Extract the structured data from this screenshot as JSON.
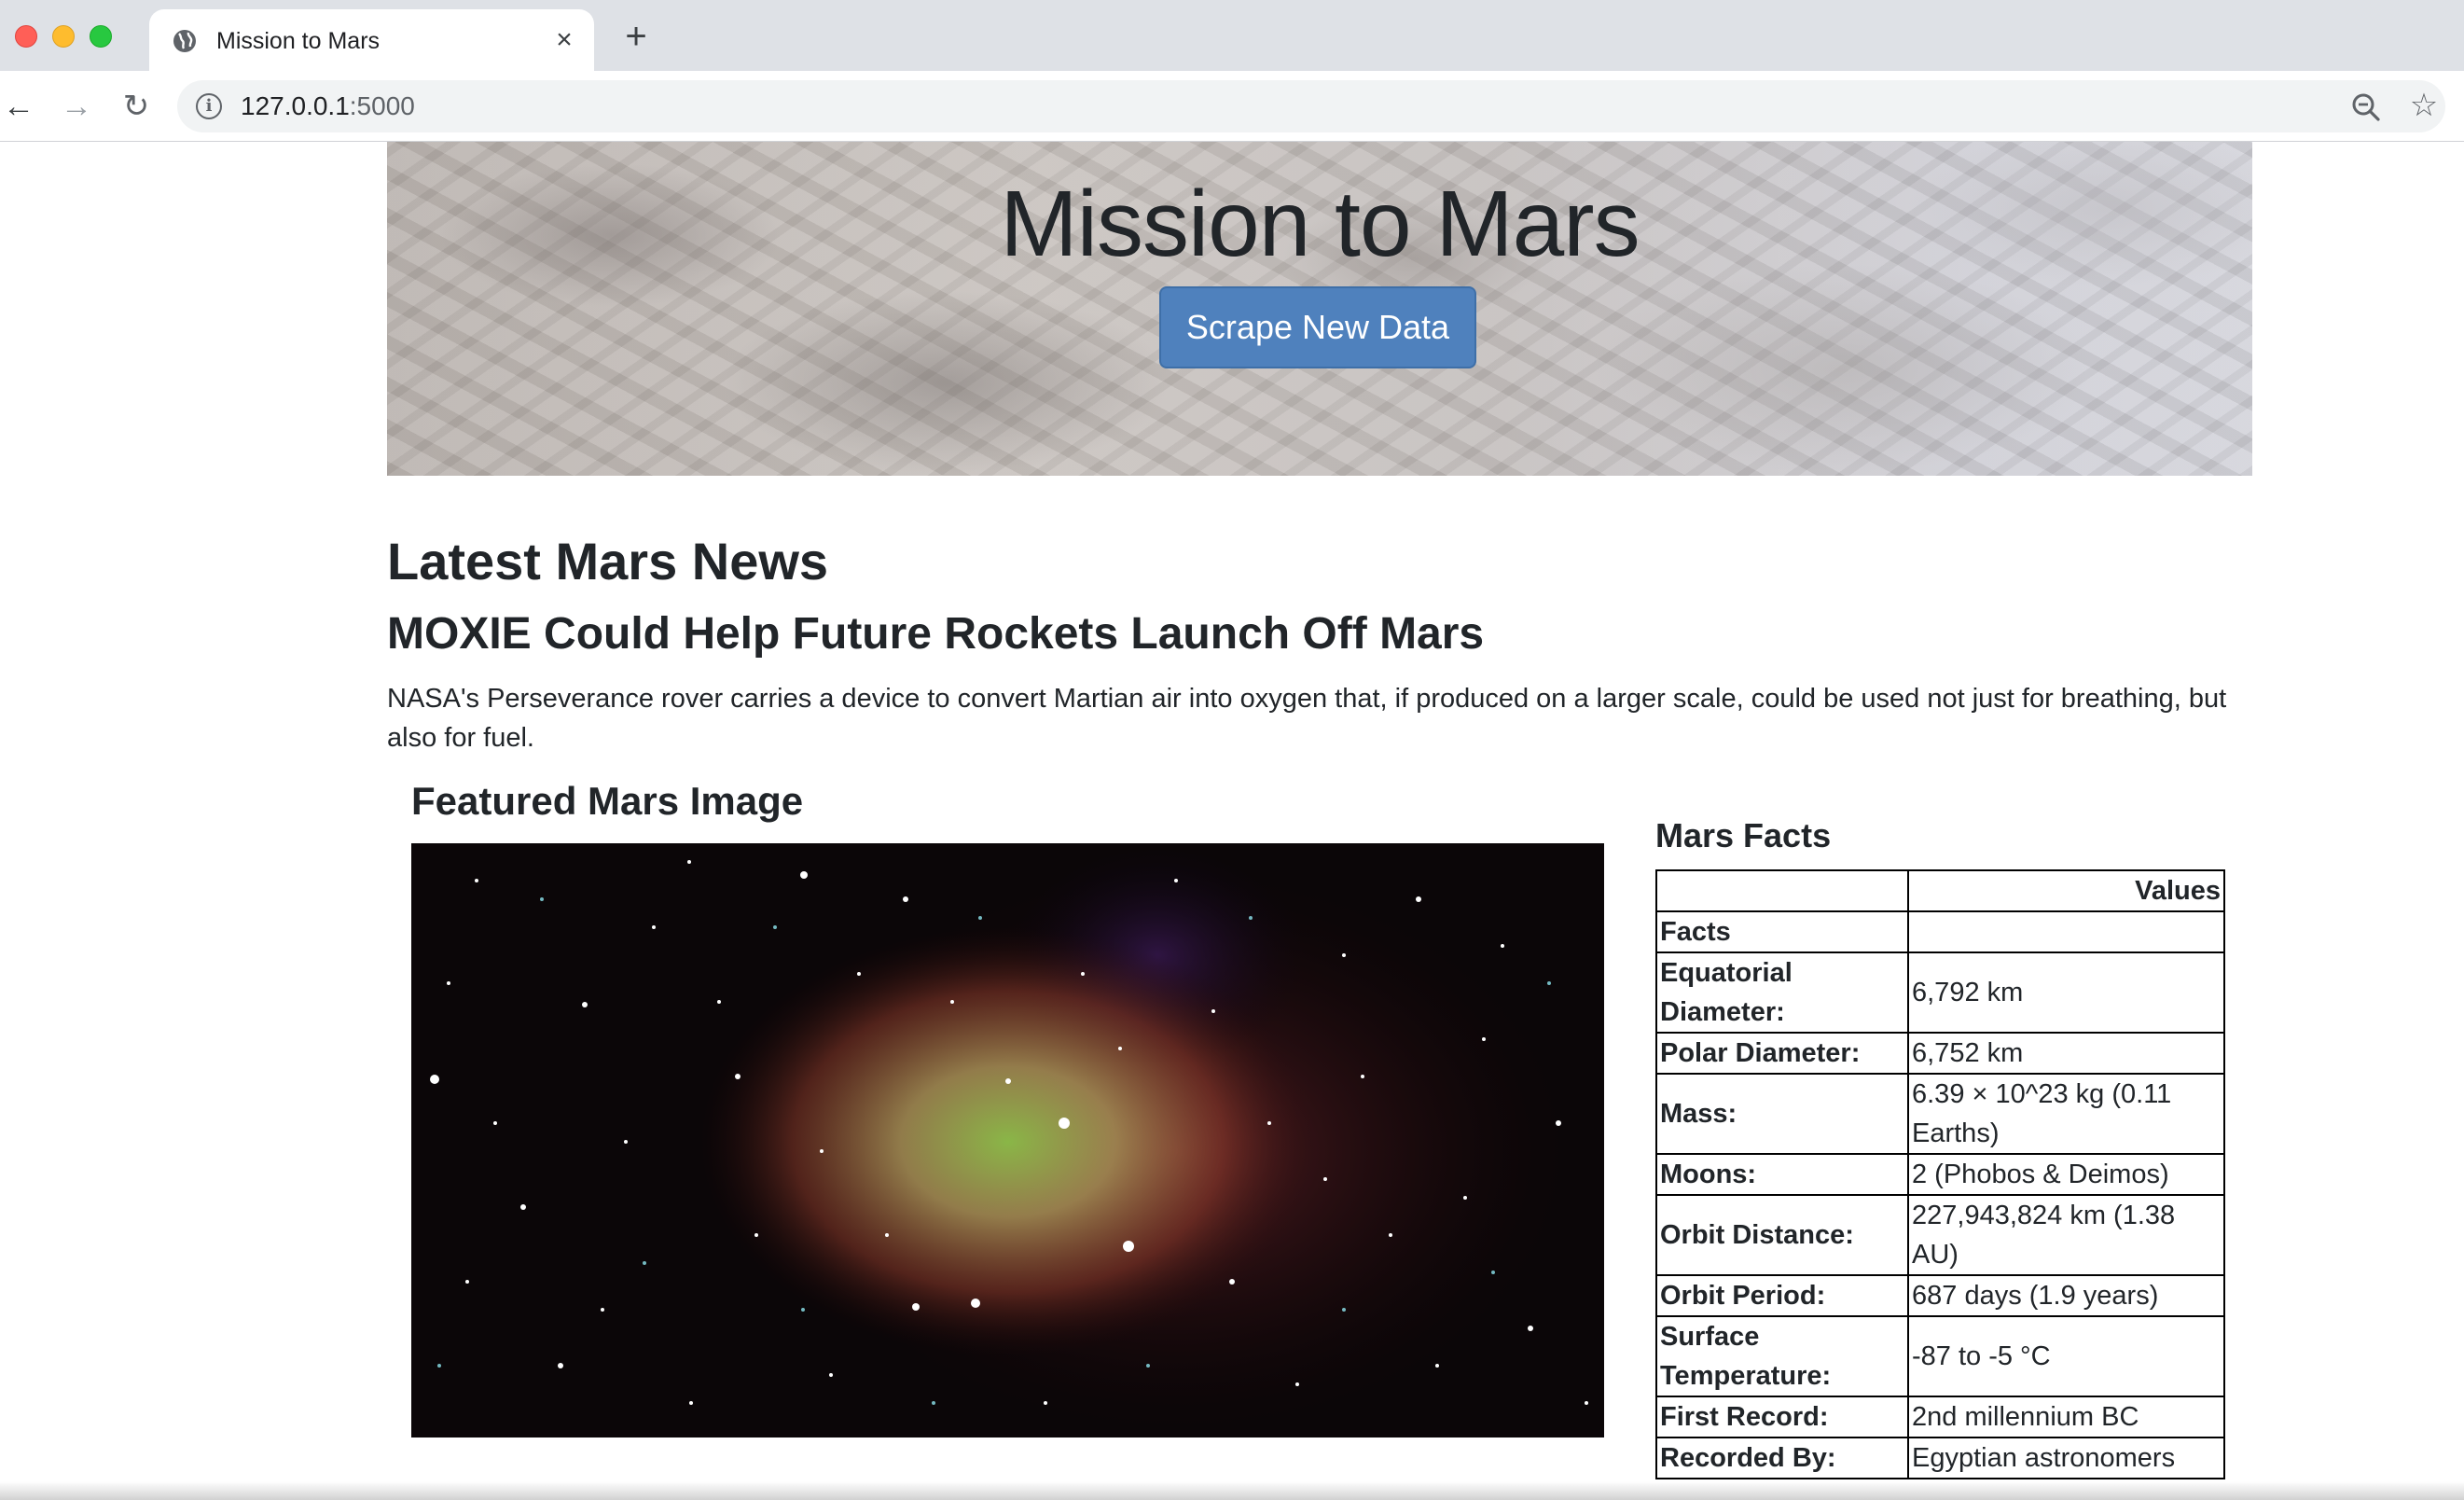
{
  "browser": {
    "tab_title": "Mission to Mars",
    "url_host": "127.0.0.1",
    "url_port": ":5000",
    "icons": {
      "tab": "globe-icon",
      "close": "close-icon",
      "new_tab": "plus-icon",
      "back": "back-arrow-icon",
      "forward": "forward-arrow-icon",
      "reload": "reload-icon",
      "site_info": "info-icon",
      "zoom": "zoom-out-icon",
      "bookmark": "star-icon"
    }
  },
  "jumbotron": {
    "title": "Mission to Mars",
    "button_label": "Scrape New Data",
    "button_color": "#4f81bd"
  },
  "news": {
    "heading": "Latest Mars News",
    "title": "MOXIE Could Help Future Rockets Launch Off Mars",
    "paragraph": "NASA's Perseverance rover carries a device to convert Martian air into oxygen that, if produced on a larger scale, could be used not just for breathing, but also for fuel."
  },
  "featured": {
    "heading": "Featured Mars Image"
  },
  "facts": {
    "heading": "Mars Facts",
    "column_header": "Values",
    "index_label": "Facts",
    "rows": [
      {
        "key": "Equatorial Diameter:",
        "value": "6,792 km"
      },
      {
        "key": "Polar Diameter:",
        "value": "6,752 km"
      },
      {
        "key": "Mass:",
        "value": "6.39 × 10^23 kg (0.11 Earths)"
      },
      {
        "key": "Moons:",
        "value": "2 (Phobos & Deimos)"
      },
      {
        "key": "Orbit Distance:",
        "value": "227,943,824 km (1.38 AU)"
      },
      {
        "key": "Orbit Period:",
        "value": "687 days (1.9 years)"
      },
      {
        "key": "Surface Temperature:",
        "value": "-87 to -5 °C"
      },
      {
        "key": "First Record:",
        "value": "2nd millennium BC"
      },
      {
        "key": "Recorded By:",
        "value": "Egyptian astronomers"
      }
    ]
  }
}
